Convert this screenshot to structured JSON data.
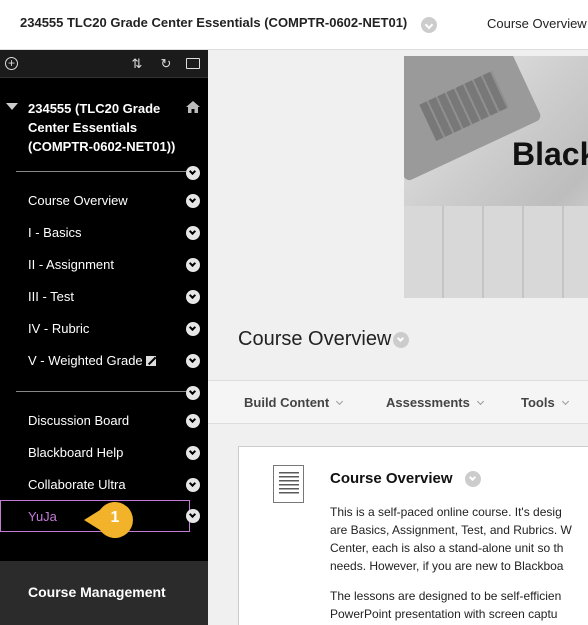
{
  "topbar": {
    "course_title": "234555 TLC20 Grade Center Essentials (COMPTR-0602-NET01)",
    "breadcrumb": "Course Overview"
  },
  "sidebar": {
    "course_name_lines": [
      "234555 (TLC20 Grade",
      "Center Essentials",
      "(COMPTR-0602-NET01))"
    ],
    "group1": [
      {
        "label": "Course Overview"
      },
      {
        "label": "I - Basics"
      },
      {
        "label": "II - Assignment"
      },
      {
        "label": "III - Test"
      },
      {
        "label": "IV - Rubric"
      },
      {
        "label": "V - Weighted Grade"
      }
    ],
    "group2": [
      {
        "label": "Discussion Board"
      },
      {
        "label": "Blackboard Help"
      },
      {
        "label": "Collaborate Ultra"
      }
    ],
    "highlighted_item": "YuJa",
    "callout_number": "1",
    "course_management": "Course Management",
    "highlight_color": "#c57ad6",
    "callout_color": "#f2b32a"
  },
  "main": {
    "banner_text": "Black",
    "page_title": "Course Overview",
    "actions": [
      {
        "label": "Build Content"
      },
      {
        "label": "Assessments"
      },
      {
        "label": "Tools"
      }
    ],
    "content_title": "Course Overview",
    "paragraph1": [
      "This is a self-paced online course. It's desig",
      "are Basics, Assignment, Test, and Rubrics. W",
      "Center, each is also a stand-alone unit so th",
      "needs. However, if you are new to Blackboa"
    ],
    "paragraph2": [
      "The lessons are designed to be self-efficien",
      "PowerPoint presentation with screen captu"
    ]
  }
}
